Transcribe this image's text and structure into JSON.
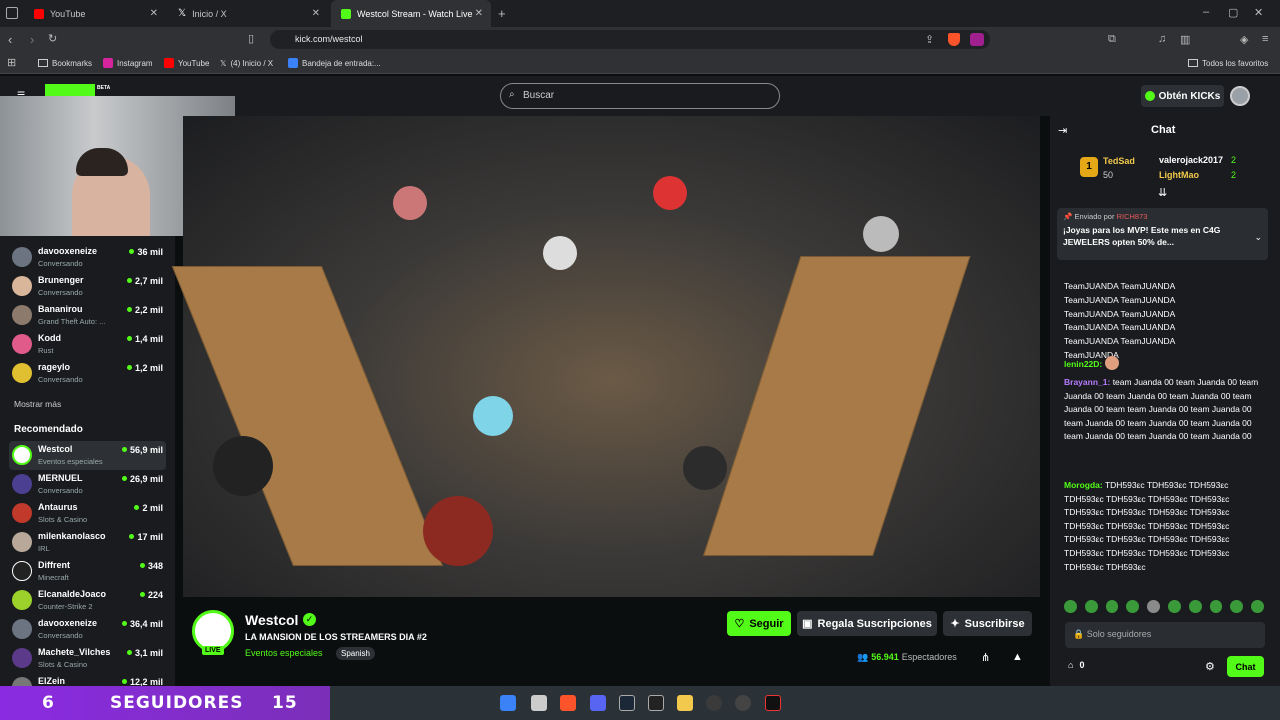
{
  "browser": {
    "tabs": [
      {
        "label": "YouTube",
        "active": false
      },
      {
        "label": "Inicio / X",
        "active": false
      },
      {
        "label": "Westcol Stream - Watch Live",
        "active": true
      }
    ],
    "url": "kick.com/westcol",
    "bookmarks": [
      "Bookmarks",
      "Instagram",
      "YouTube",
      "(4) Inicio / X",
      "Bandeja de entrada:..."
    ],
    "all_favorites": "Todos los favoritos"
  },
  "kick": {
    "logo_badge": "BETA",
    "search_placeholder": "Buscar",
    "get_kicks": "Obtén KICKs",
    "sidebar": {
      "following": [
        {
          "name": "davooxeneize",
          "category": "Conversando",
          "viewers": "36 mil"
        },
        {
          "name": "Brunenger",
          "category": "Conversando",
          "viewers": "2,7 mil"
        },
        {
          "name": "Bananirou",
          "category": "Grand Theft Auto: ...",
          "viewers": "2,2 mil"
        },
        {
          "name": "Kodd",
          "category": "Rust",
          "viewers": "1,4 mil"
        },
        {
          "name": "rageylo",
          "category": "Conversando",
          "viewers": "1,2 mil"
        }
      ],
      "show_more": "Mostrar más",
      "recommended_title": "Recomendado",
      "recommended": [
        {
          "name": "Westcol",
          "category": "Eventos especiales",
          "viewers": "56,9 mil"
        },
        {
          "name": "MERNUEL",
          "category": "Conversando",
          "viewers": "26,9 mil"
        },
        {
          "name": "Antaurus",
          "category": "Slots & Casino",
          "viewers": "2 mil"
        },
        {
          "name": "milenkanolasco",
          "category": "IRL",
          "viewers": "17 mil"
        },
        {
          "name": "Diffrent",
          "category": "Minecraft",
          "viewers": "348"
        },
        {
          "name": "ElcanaldeJoaco",
          "category": "Counter-Strike 2",
          "viewers": "224"
        },
        {
          "name": "davooxeneize",
          "category": "Conversando",
          "viewers": "36,4 mil"
        },
        {
          "name": "Machete_Vilches",
          "category": "Slots & Casino",
          "viewers": "3,1 mil"
        },
        {
          "name": "ElZein",
          "category": "",
          "viewers": "12,2 mil"
        }
      ]
    },
    "stream": {
      "channel": "Westcol",
      "title": "LA MANSION DE LOS STREAMERS DIA #2",
      "category": "Eventos especiales",
      "language": "Spanish",
      "live_badge": "LIVE",
      "follow": "Seguir",
      "gift_subs": "Regala Suscripciones",
      "subscribe": "Suscribirse",
      "viewers": "56.941",
      "viewers_label": "Espectadores"
    },
    "chat": {
      "title": "Chat",
      "leaderboard": [
        {
          "name": "TedSad",
          "value": "50"
        },
        {
          "name": "valerojack2017",
          "value": "2"
        },
        {
          "name": "LightMao",
          "value": "2"
        }
      ],
      "pinned_by_label": "Enviado por",
      "pinned_by_user": "RICH873",
      "pinned_text": "¡Joyas para los MVP! Este mes en C4G JEWELERS opten 50% de...",
      "team_lines": [
        "TeamJUANDA TeamJUANDA",
        "TeamJUANDA TeamJUANDA",
        "TeamJUANDA TeamJUANDA",
        "TeamJUANDA TeamJUANDA",
        "TeamJUANDA TeamJUANDA",
        "TeamJUANDA"
      ],
      "msg_user1": "lenin22D:",
      "msg_user2": "Brayann_1:",
      "msg_text2": "team Juanda 00 team Juanda 00 team Juanda 00 team Juanda 00 team Juanda 00 team Juanda 00 team team Juanda 00 team Juanda 00 team Juanda 00 team Juanda 00 team Juanda 00 team Juanda 00 team Juanda 00 team Juanda 00",
      "msg_user3": "Morogda:",
      "msg_text3": "TDH593εc TDH593εc TDH593εc TDH593εc TDH593εc TDH593εc TDH593εc TDH593εc TDH593εc TDH593εc TDH593εc TDH593εc TDH593εc TDH593εc TDH593εc TDH593εc TDH593εc TDH593εc TDH593εc TDH593εc TDH593εc TDH593εc TDH593εc TDH593εc TDH593εc",
      "input_placeholder": "Solo seguidores",
      "points": "0",
      "send": "Chat"
    }
  },
  "overlay": {
    "left": "6",
    "middle": "SEGUIDORES",
    "right": "15"
  },
  "colors": {
    "kick_green": "#53fc18",
    "bg": "#0b0e0f",
    "panel": "#191b1f",
    "purple": "#8a2be2"
  }
}
